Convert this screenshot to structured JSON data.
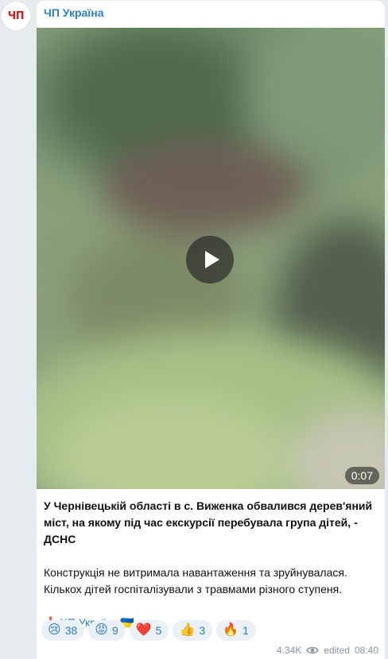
{
  "channel": {
    "name": "ЧП Україна",
    "avatar_text": "ЧП"
  },
  "video": {
    "duration": "0:07"
  },
  "post": {
    "headline": "У Чернівецькій області в с. Виженка обвалився дерев'яний міст, на якому під час екскурсії перебувала група дітей, - ДСНС",
    "body": "Конструкція не витримала навантаження та зруйнувалася. Кількох дітей госпіталізували з травмами різного ступеня.",
    "footer_mark": "❗",
    "footer_link": "ЧП Україна",
    "footer_flag": "🇺🇦"
  },
  "reactions": [
    {
      "emoji": "😢",
      "count": "38"
    },
    {
      "emoji": "😡",
      "count": "9"
    },
    {
      "emoji": "❤️",
      "count": "5"
    },
    {
      "emoji": "👍",
      "count": "3"
    },
    {
      "emoji": "🔥",
      "count": "1"
    }
  ],
  "meta": {
    "views": "4.34K",
    "edited": "edited",
    "time": "08:40"
  }
}
